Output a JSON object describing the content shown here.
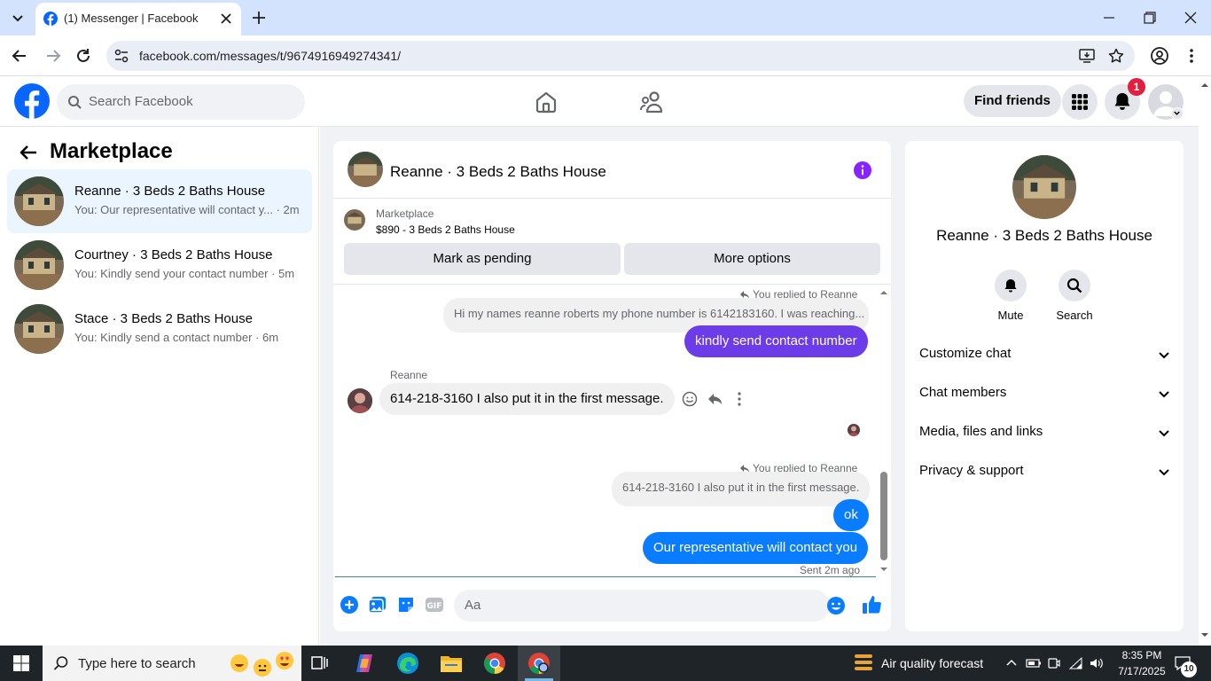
{
  "browser": {
    "tab_title": "(1) Messenger | Facebook",
    "url": "facebook.com/messages/t/9674916949274341/"
  },
  "header": {
    "search_placeholder": "Search Facebook",
    "find_friends": "Find friends",
    "notification_count": "1"
  },
  "sidebar": {
    "title": "Marketplace",
    "conversations": [
      {
        "name": "Reanne · 3 Beds 2 Baths House",
        "preview": "You: Our representative will contact y... · 2m"
      },
      {
        "name": "Courtney · 3 Beds 2 Baths House",
        "preview": "You: Kindly send your contact number · 5m"
      },
      {
        "name": "Stace · 3 Beds 2 Baths House",
        "preview": "You: Kindly send a contact number · 6m"
      }
    ]
  },
  "chat": {
    "title": "Reanne · 3 Beds 2 Baths House",
    "marketplace_label": "Marketplace",
    "listing": "$890 - 3 Beds 2 Baths House",
    "mark_pending": "Mark as pending",
    "more_options": "More options",
    "replied_1": "You replied to Reanne",
    "quote_1": "Hi my names reanne roberts my phone number is 6142183160. I was reaching...",
    "msg_out_1": "kindly send contact number",
    "sender_name": "Reanne",
    "msg_in_1": "614-218-3160 I also put it in the first message.",
    "replied_2": "You replied to Reanne",
    "quote_2": "614-218-3160 I also put it in the first message.",
    "msg_out_2": "ok",
    "msg_out_3": "Our representative will contact you",
    "sent_status": "Sent 2m ago",
    "composer_placeholder": "Aa"
  },
  "details": {
    "name": "Reanne · 3 Beds 2 Baths House",
    "mute": "Mute",
    "search": "Search",
    "sections": [
      "Customize chat",
      "Chat members",
      "Media, files and links",
      "Privacy & support"
    ]
  },
  "taskbar": {
    "search_text": "Type here to search",
    "weather": "Air quality forecast",
    "time": "8:35 PM",
    "date": "7/17/2025",
    "notif_count": "10"
  },
  "colors": {
    "fb_blue": "#0866ff",
    "messenger_blue": "#0a7cff",
    "purple": "#6b3ce8",
    "notif_red": "#e41e3f"
  }
}
